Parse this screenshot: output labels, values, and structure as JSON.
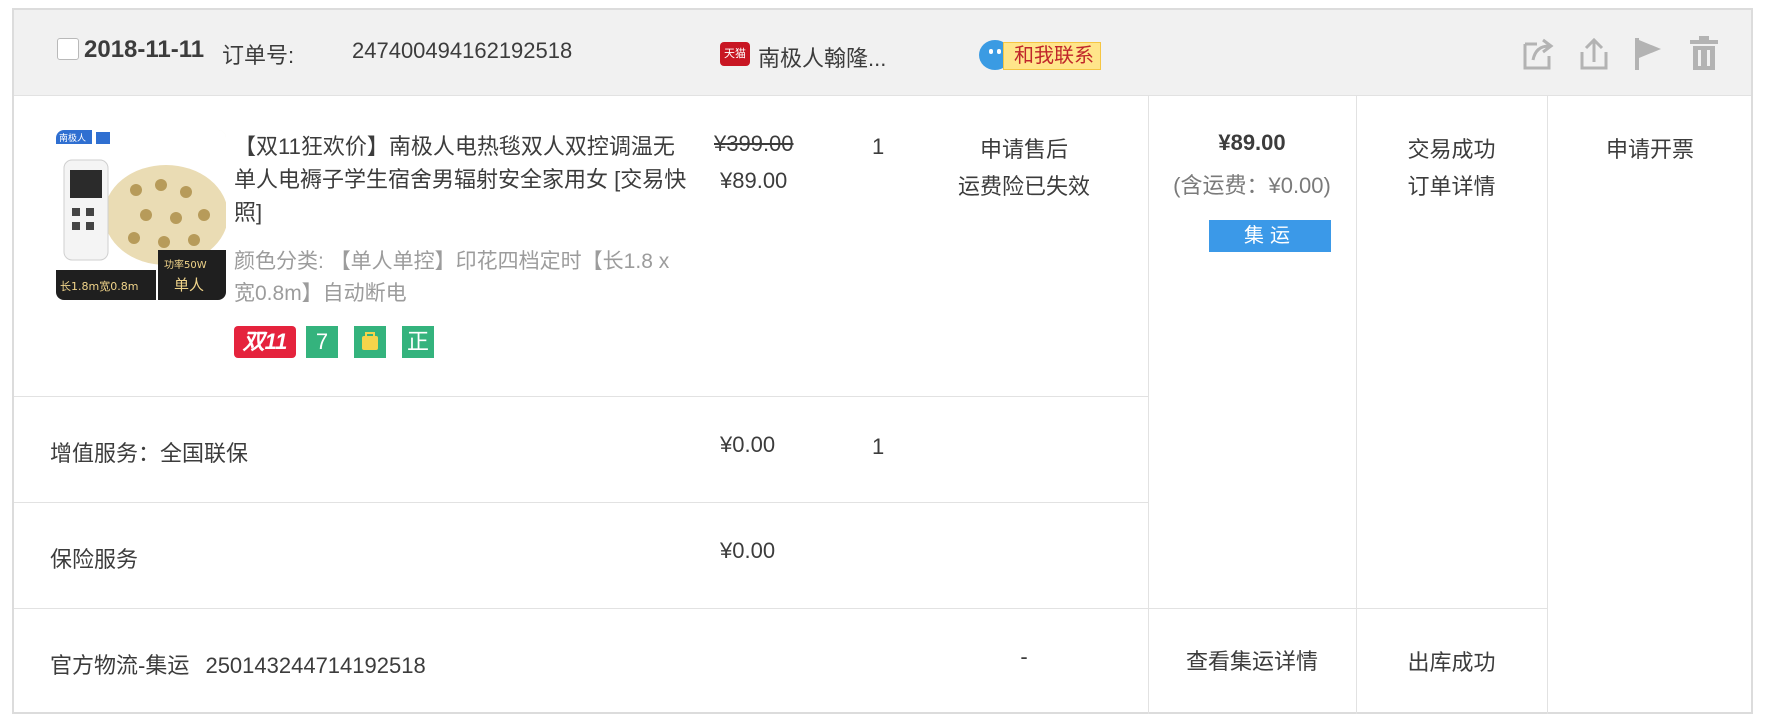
{
  "header": {
    "date": "2018-11-11",
    "order_no_label": "订单号:",
    "order_no": "247400494162192518",
    "shop_badge": "天猫",
    "shop_name": "南极人翰隆...",
    "contact_label": "和我联系"
  },
  "product": {
    "title": "【双11狂欢价】南极人电热毯双人双控调温无单人电褥子学生宿舍男辐射安全家用女 [交易快照]",
    "sku_label": "颜色分类:",
    "sku_value": "【单人单控】印花四档定时【长1.8 x 宽0.8m】自动断电",
    "badges": {
      "double11": "双11",
      "seven": "7",
      "bag": "",
      "genuine": "正"
    },
    "thumb_text": {
      "brand": "南极人",
      "size": "长1.8m宽0.8m",
      "power": "功率50W",
      "type": "单人"
    },
    "original_price": "¥399.00",
    "price": "¥89.00",
    "quantity": "1",
    "aftersale": "申请售后",
    "insurance_status": "运费险已失效"
  },
  "summary": {
    "total": "¥89.00",
    "shipping": "(含运费：¥0.00)",
    "jiyun_tag": "集运",
    "status": "交易成功",
    "detail_link": "订单详情",
    "invoice": "申请开票"
  },
  "services": [
    {
      "label": "增值服务：全国联保",
      "price": "¥0.00",
      "qty": "1"
    },
    {
      "label": "保险服务",
      "price": "¥0.00",
      "qty": ""
    }
  ],
  "logistics": {
    "label": "官方物流-集运",
    "tracking": "250143244714192518",
    "dash": "-",
    "detail_link": "查看集运详情",
    "status": "出库成功"
  },
  "colors": {
    "header_bg": "#f1f1f1",
    "border": "#e2e2e2",
    "accent_blue": "#3b99e8",
    "double11_red": "#e5233d",
    "badge_green": "#34b37d",
    "tmall_red": "#c81623"
  }
}
